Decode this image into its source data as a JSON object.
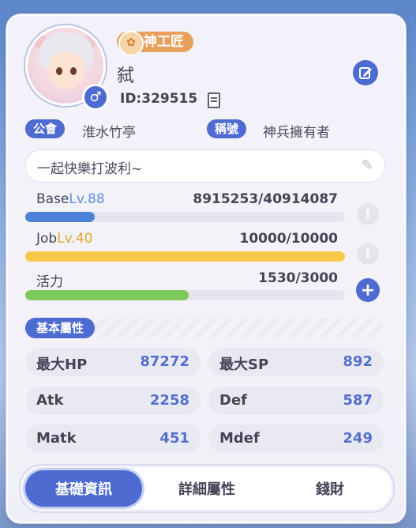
{
  "profile": {
    "job_title": "神工匠",
    "name": "弑",
    "id": "ID:329515",
    "gender_symbol": "♂",
    "guild_tag": "公會",
    "guild_name": "淮水竹亭",
    "title_tag": "稱號",
    "title_name": "神兵擁有者",
    "motto": "一起快樂打波利~"
  },
  "stats": {
    "base": {
      "label": "Base",
      "level": "Lv.88",
      "value": "8915253/40914087",
      "fill_fraction": 0.218,
      "color": "#4d82d8"
    },
    "job": {
      "label": "Job",
      "level": "Lv.40",
      "value": "10000/10000",
      "fill_fraction": 1.0,
      "color": "#f7c948"
    },
    "vitality": {
      "label": "活力",
      "value": "1530/3000",
      "fill_fraction": 0.51,
      "color": "#7ec95b"
    }
  },
  "attributes": {
    "section_label": "基本屬性",
    "items": [
      {
        "name": "最大HP",
        "value": "87272"
      },
      {
        "name": "最大SP",
        "value": "892"
      },
      {
        "name": "Atk",
        "value": "2258"
      },
      {
        "name": "Def",
        "value": "587"
      },
      {
        "name": "Matk",
        "value": "451"
      },
      {
        "name": "Mdef",
        "value": "249"
      }
    ]
  },
  "tabs": [
    {
      "label": "基礎資訊",
      "active": true
    },
    {
      "label": "詳細屬性",
      "active": false
    },
    {
      "label": "錢財",
      "active": false
    }
  ],
  "icons": {
    "job": "gear-icon",
    "edit": "edit-icon",
    "copy": "copy-icon",
    "info": "exclamation-icon",
    "add": "plus-icon",
    "motto_edit": "pencil-icon"
  }
}
